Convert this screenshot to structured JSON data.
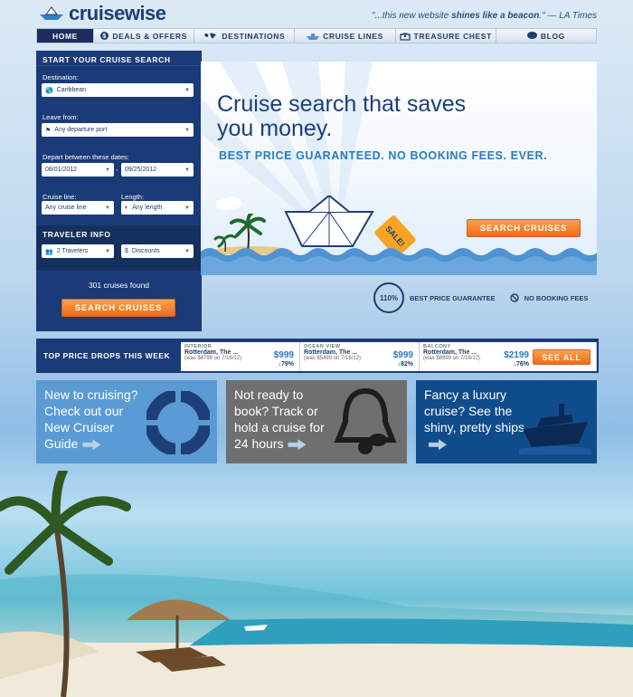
{
  "header": {
    "logo": "cruisewise",
    "tagline_pre": "\"...this new website ",
    "tagline_bold": "shines like a beacon",
    "tagline_post": ".\" — LA Times"
  },
  "nav": {
    "items": [
      "HOME",
      "DEALS & OFFERS",
      "DESTINATIONS",
      "CRUISE LINES",
      "TREASURE CHEST",
      "BLOG"
    ]
  },
  "search": {
    "title": "START YOUR CRUISE SEARCH",
    "destination_label": "Destination:",
    "destination_value": "Caribbean",
    "leave_label": "Leave from:",
    "leave_value": "Any departure port",
    "dates_label": "Depart between these dates:",
    "date_from": "08/01/2012",
    "date_sep": "-",
    "date_to": "09/25/2012",
    "line_label": "Cruise line:",
    "line_value": "Any cruise line",
    "length_label": "Length:",
    "length_value": "Any length",
    "traveler_title": "TRAVELER INFO",
    "travelers_value": "2 Travelers",
    "discounts_value": "Discounts",
    "found": "301 cruises found",
    "button": "SEARCH CRUISES"
  },
  "hero": {
    "headline": "Cruise search that saves you money.",
    "subhead": "BEST PRICE GUARANTEED. NO BOOKING FEES. EVER.",
    "sale_tag": "SALE!",
    "button": "SEARCH CRUISES"
  },
  "badges": {
    "percent": "110%",
    "guarantee": "BEST PRICE GUARANTEE",
    "no_fees": "NO BOOKING FEES"
  },
  "price_drops": {
    "title": "TOP PRICE DROPS THIS WEEK",
    "items": [
      {
        "category": "INTERIOR",
        "ship": "Rotterdam, The ...",
        "price": "$999",
        "was": "(was $4799 on 7/16/12)",
        "pct": "↓79%"
      },
      {
        "category": "OCEAN VIEW",
        "ship": "Rotterdam, The ...",
        "price": "$999",
        "was": "(was $5499 on 7/16/12)",
        "pct": "↓82%"
      },
      {
        "category": "BALCONY",
        "ship": "Rotterdam, The ...",
        "price": "$2199",
        "was": "(was $8999 on 7/16/12)",
        "pct": "↓76%"
      }
    ],
    "see_all": "SEE ALL"
  },
  "promos": [
    {
      "text": "New to cruising? Check out our New Cruiser Guide",
      "icon": "life-ring-icon"
    },
    {
      "text": "Not ready to book? Track or hold a cruise for 24 hours",
      "icon": "bell-icon"
    },
    {
      "text": "Fancy a luxury cruise? See the shiny, pretty ships",
      "icon": "ship-icon"
    }
  ],
  "colors": {
    "navy": "#1b3a78",
    "accent_orange": "#f47a20",
    "promo_blue": "#5b9bd5",
    "promo_gray": "#6f6f6f",
    "promo_navy": "#0f4c8c"
  }
}
